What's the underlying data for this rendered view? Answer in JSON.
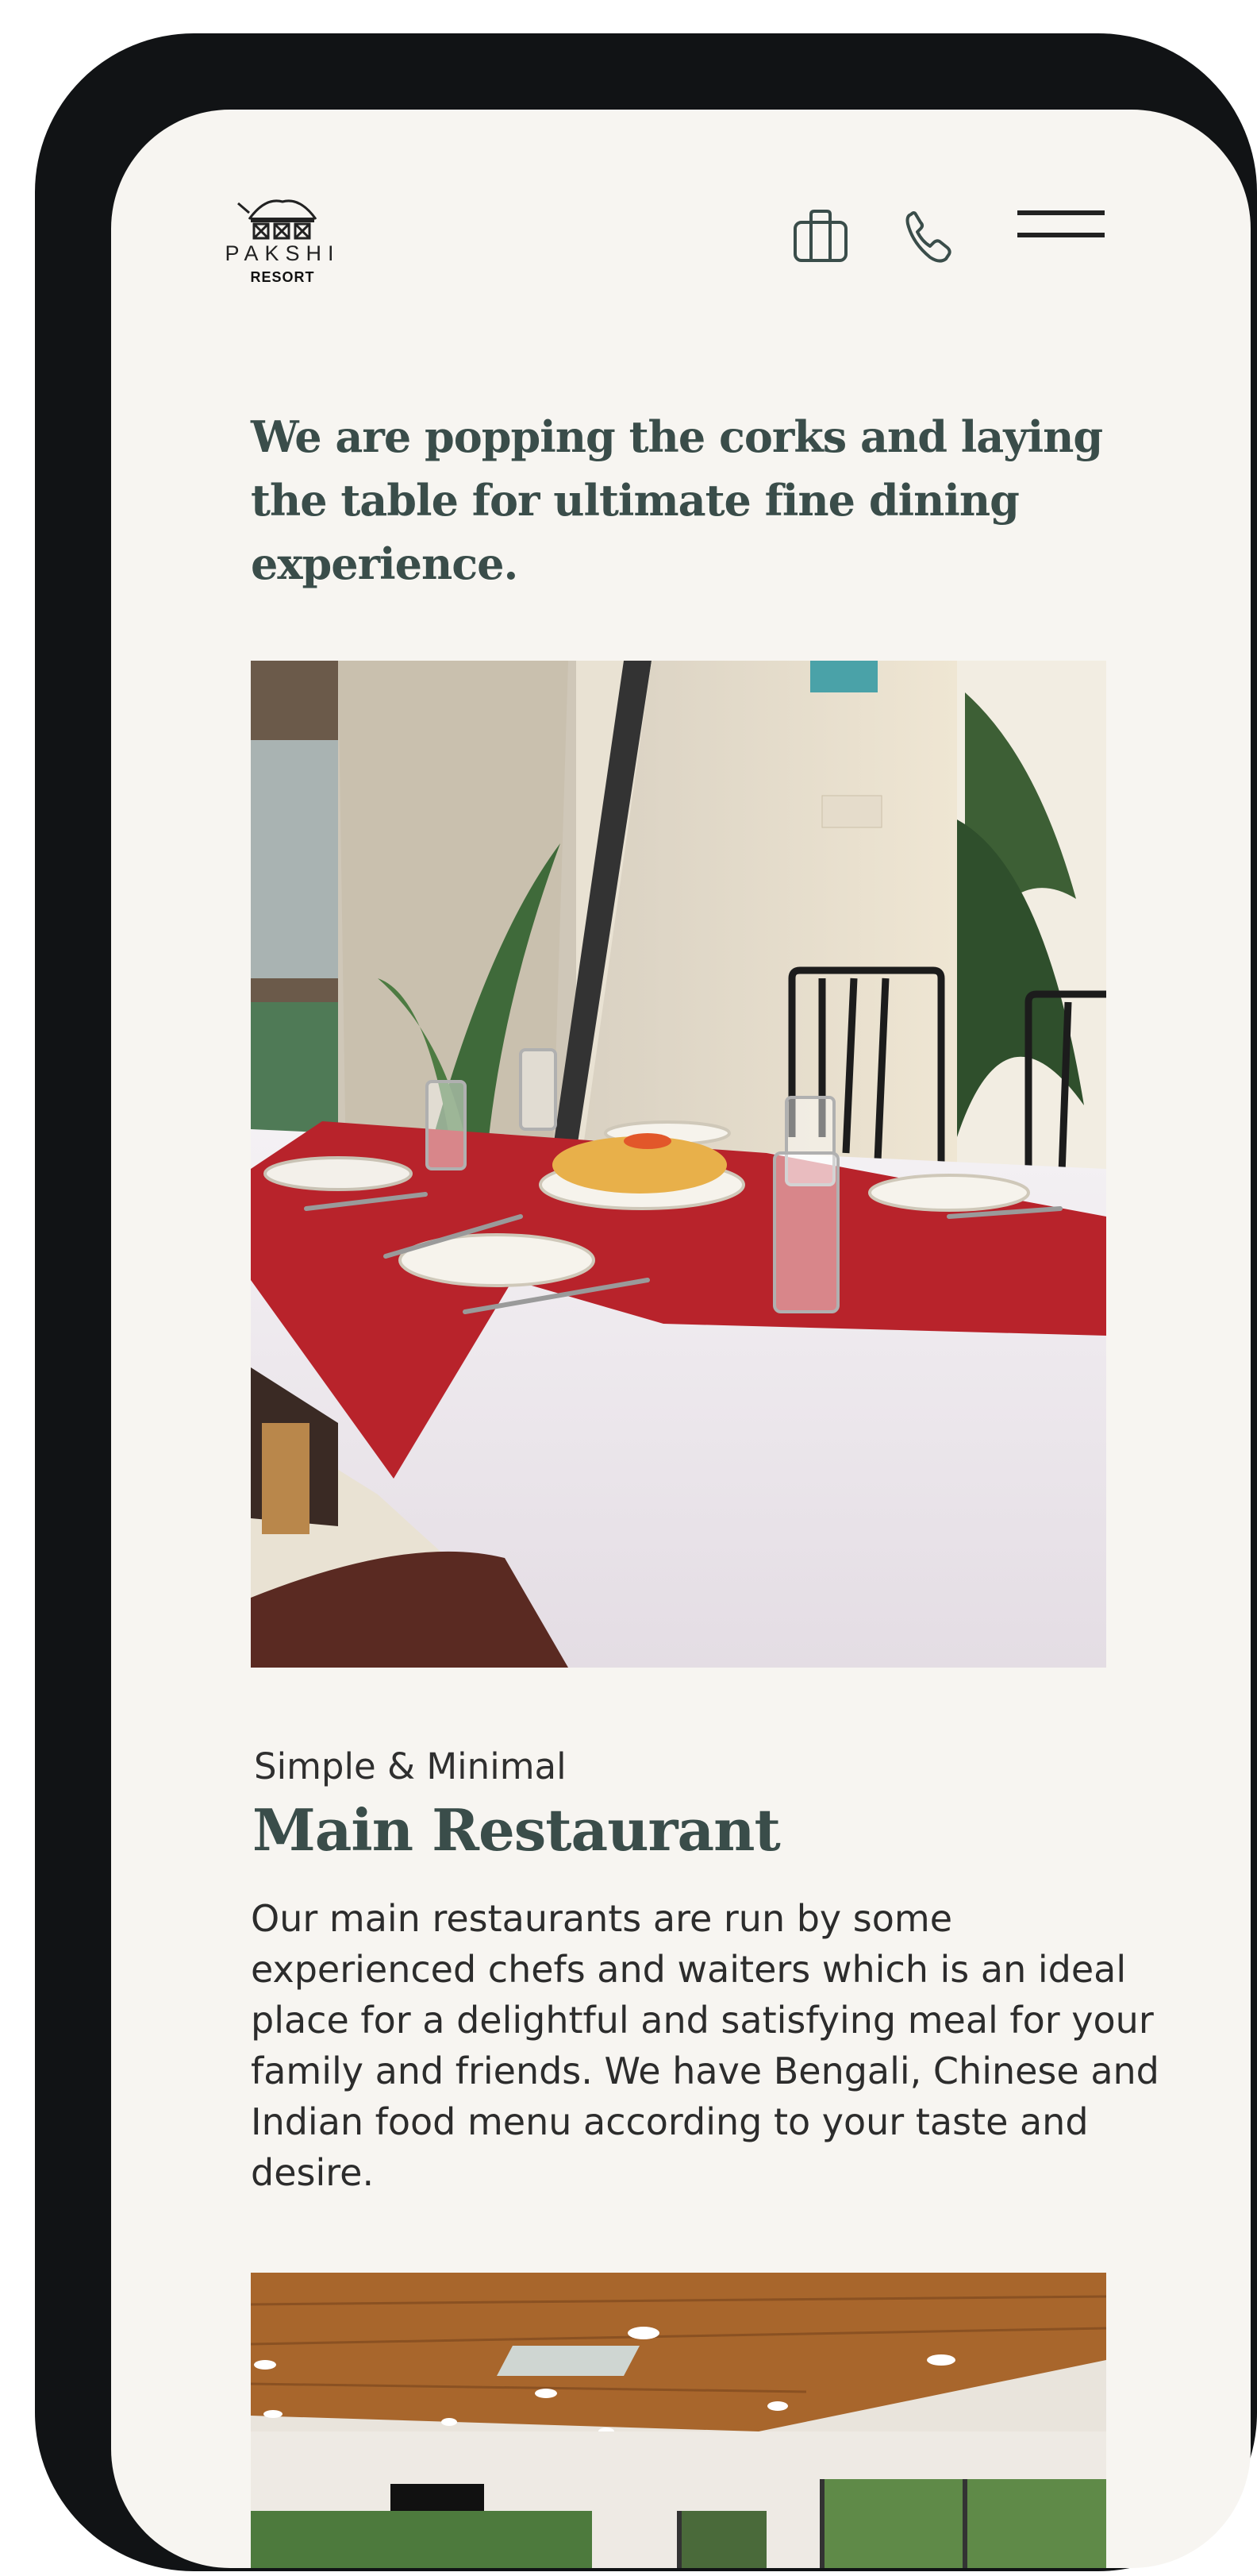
{
  "brand": {
    "name": "PAKSHI",
    "sub": "RESORT"
  },
  "header": {
    "icons": [
      "briefcase-icon",
      "phone-icon",
      "hamburger-menu-icon"
    ]
  },
  "hero": {
    "headline": "We are popping the corks and laying the table for ultimate fine dining experience."
  },
  "section": {
    "kicker": "Simple & Minimal",
    "title": "Main Restaurant",
    "description": "Our main restaurants are run by some experienced chefs and waiters which is an ideal place for a delightful and satisfying meal for your family and friends. We have Bengali, Chinese and Indian food menu according to your taste and desire."
  },
  "colors": {
    "background": "#f7f5f1",
    "heading": "#3a4d4a",
    "frame": "#111315",
    "tablecloth_red": "#b8232b"
  }
}
